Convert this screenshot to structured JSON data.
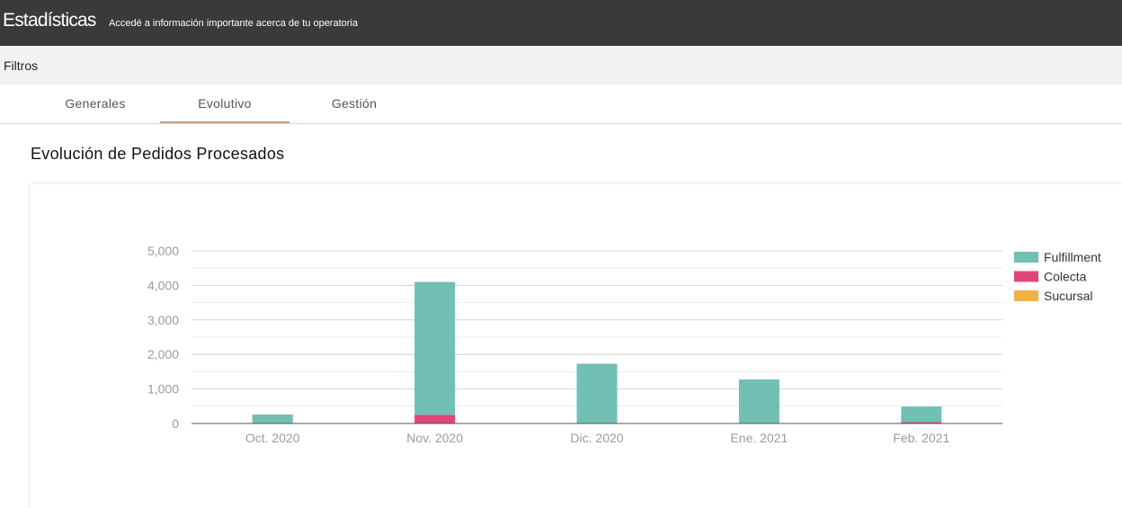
{
  "header": {
    "title": "Estadísticas",
    "subtitle": "Accedé a información importante acerca de tu operatoria"
  },
  "filters": {
    "label": "Filtros"
  },
  "tabs": [
    {
      "label": "Generales",
      "active": false
    },
    {
      "label": "Evolutivo",
      "active": true
    },
    {
      "label": "Gestión",
      "active": false
    }
  ],
  "section": {
    "title": "Evolución de Pedidos Procesados"
  },
  "colors": {
    "fulfillment": "#72bfb3",
    "colecta": "#e0457b",
    "sucursal": "#f0b04a",
    "tab_indicator": "#c9a07a"
  },
  "chart_data": {
    "type": "bar",
    "stacked": true,
    "title": "",
    "xlabel": "",
    "ylabel": "",
    "categories": [
      "Oct. 2020",
      "Nov. 2020",
      "Dic. 2020",
      "Ene. 2021",
      "Feb. 2021"
    ],
    "series": [
      {
        "name": "Fulfillment",
        "color": "#72bfb3",
        "values": [
          260,
          3850,
          1720,
          1270,
          450
        ]
      },
      {
        "name": "Colecta",
        "color": "#e0457b",
        "values": [
          0,
          250,
          10,
          5,
          40
        ]
      },
      {
        "name": "Sucursal",
        "color": "#f0b04a",
        "values": [
          0,
          0,
          0,
          0,
          0
        ]
      }
    ],
    "ylim": [
      0,
      5000
    ],
    "yticks": [
      0,
      1000,
      2000,
      3000,
      4000,
      5000
    ],
    "ytick_labels": [
      "0",
      "1,000",
      "2,000",
      "3,000",
      "4,000",
      "5,000"
    ],
    "grid": true,
    "legend_position": "right"
  }
}
